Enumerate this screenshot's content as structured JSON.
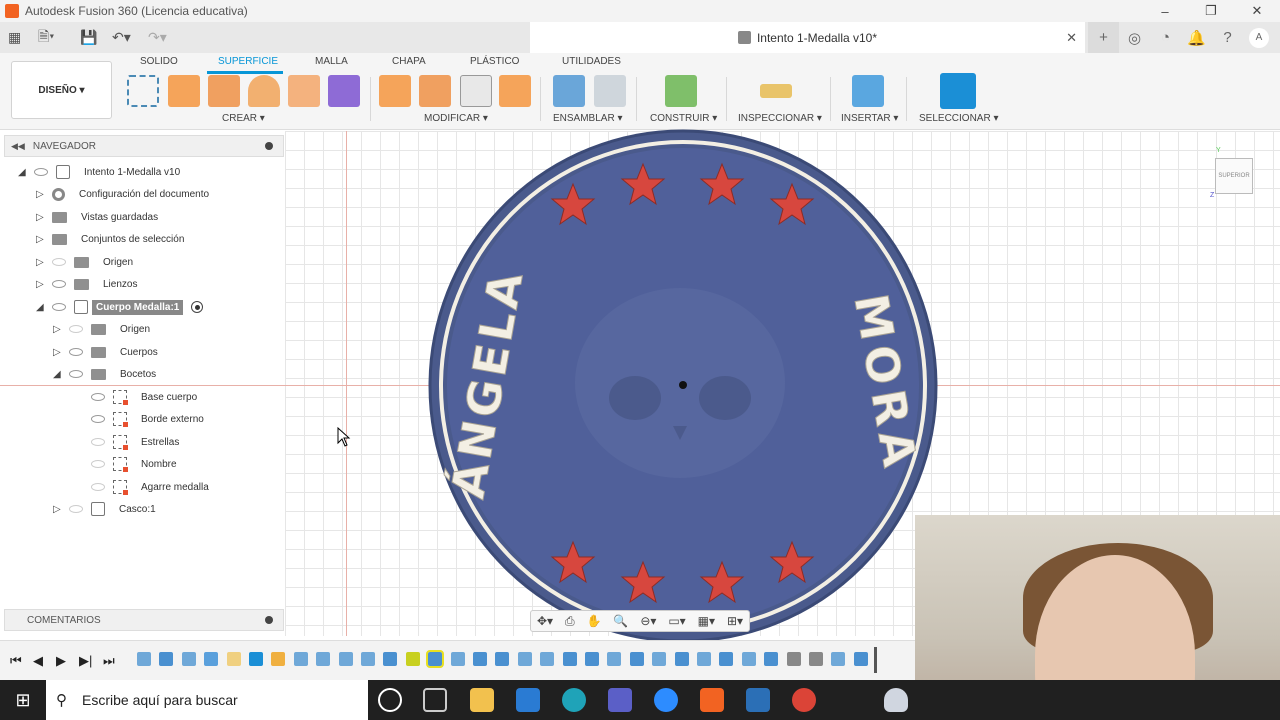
{
  "window": {
    "title": "Autodesk Fusion 360 (Licencia educativa)",
    "minimize": "–",
    "restore": "❐",
    "close": "✕"
  },
  "document_tab": {
    "title": "Intento 1-Medalla v10*",
    "close": "✕"
  },
  "ribbon": {
    "workspace": "DISEÑO ▾",
    "tabs": [
      "SOLIDO",
      "SUPERFICIE",
      "MALLA",
      "CHAPA",
      "PLÁSTICO",
      "UTILIDADES"
    ],
    "active_tab": "SUPERFICIE",
    "groups": [
      "CREAR ▾",
      "MODIFICAR ▾",
      "ENSAMBLAR ▾",
      "CONSTRUIR ▾",
      "INSPECCIONAR ▾",
      "INSERTAR ▾",
      "SELECCIONAR ▾"
    ]
  },
  "browser": {
    "header": "NAVEGADOR",
    "items": [
      {
        "label": "Intento 1-Medalla v10"
      },
      {
        "label": "Configuración del documento"
      },
      {
        "label": "Vistas guardadas"
      },
      {
        "label": "Conjuntos de selección"
      },
      {
        "label": "Origen"
      },
      {
        "label": "Lienzos"
      },
      {
        "label": "Cuerpo Medalla:1"
      },
      {
        "label": "Origen"
      },
      {
        "label": "Cuerpos"
      },
      {
        "label": "Bocetos"
      },
      {
        "label": "Base cuerpo"
      },
      {
        "label": "Borde externo"
      },
      {
        "label": "Estrellas"
      },
      {
        "label": "Nombre"
      },
      {
        "label": "Agarre medalla"
      },
      {
        "label": "Casco:1"
      }
    ]
  },
  "comments": {
    "header": "COMENTARIOS"
  },
  "viewcube": {
    "face": "SUPERIOR",
    "y": "Y",
    "z": "Z"
  },
  "medal": {
    "left_text": "ÁNGELA",
    "right_text": "MORA",
    "disc_color": "#4a5a8c",
    "star_color": "#d7473e",
    "text_color": "#f3efe4"
  },
  "taskbar": {
    "search_placeholder": "Escribe aquí para buscar"
  }
}
